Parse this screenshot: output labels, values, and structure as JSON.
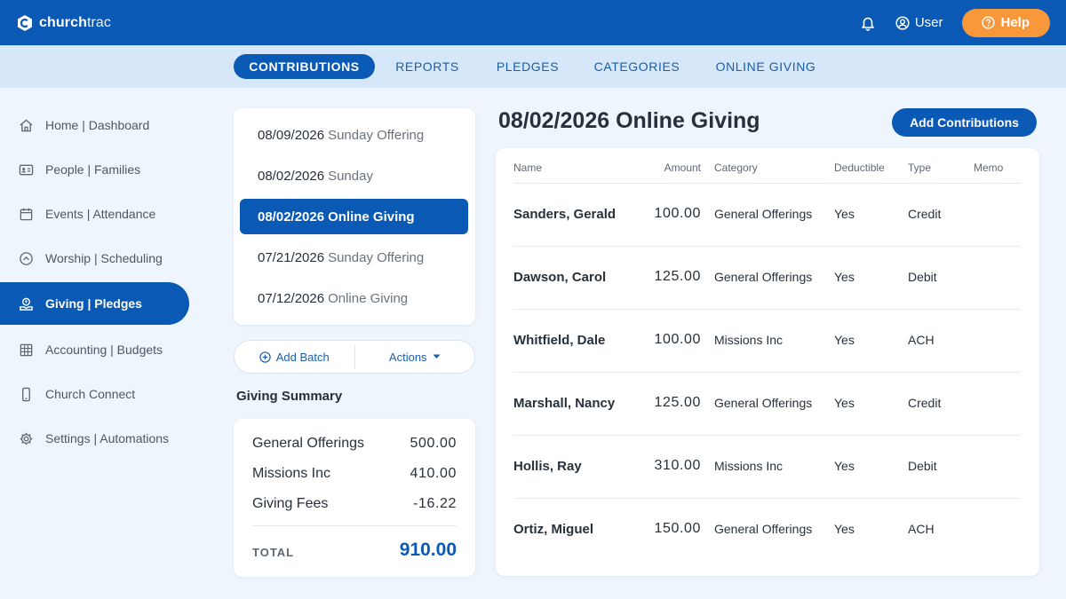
{
  "app": {
    "brand_bold": "church",
    "brand_light": "trac"
  },
  "header": {
    "user_label": "User",
    "help_label": "Help"
  },
  "tabs": [
    {
      "label": "CONTRIBUTIONS",
      "active": true
    },
    {
      "label": "REPORTS",
      "active": false
    },
    {
      "label": "PLEDGES",
      "active": false
    },
    {
      "label": "CATEGORIES",
      "active": false
    },
    {
      "label": "ONLINE GIVING",
      "active": false
    }
  ],
  "sidebar": {
    "items": [
      {
        "label": "Home | Dashboard",
        "icon": "home-icon"
      },
      {
        "label": "People | Families",
        "icon": "id-card-icon"
      },
      {
        "label": "Events | Attendance",
        "icon": "calendar-icon"
      },
      {
        "label": "Worship | Scheduling",
        "icon": "chevron-circle-icon"
      },
      {
        "label": "Giving | Pledges",
        "icon": "giving-hand-icon",
        "active": true
      },
      {
        "label": "Accounting | Budgets",
        "icon": "grid-icon"
      },
      {
        "label": "Church Connect",
        "icon": "phone-icon"
      },
      {
        "label": "Settings | Automations",
        "icon": "gear-icon"
      }
    ]
  },
  "batches": [
    {
      "date": "08/09/2026",
      "name": "Sunday Offering"
    },
    {
      "date": "08/02/2026",
      "name": "Sunday"
    },
    {
      "date": "08/02/2026",
      "name": "Online Giving",
      "active": true
    },
    {
      "date": "07/21/2026",
      "name": "Sunday Offering"
    },
    {
      "date": "07/12/2026",
      "name": "Online Giving"
    }
  ],
  "batch_actions": {
    "add_label": "Add Batch",
    "actions_label": "Actions"
  },
  "summary": {
    "title": "Giving Summary",
    "rows": [
      {
        "label": "General Offerings",
        "value": "500.00"
      },
      {
        "label": "Missions Inc",
        "value": "410.00"
      },
      {
        "label": "Giving Fees",
        "value": "-16.22"
      }
    ],
    "total_label": "TOTAL",
    "total_value": "910.00"
  },
  "main": {
    "title": "08/02/2026 Online Giving",
    "add_button": "Add Contributions",
    "columns": {
      "name": "Name",
      "amount": "Amount",
      "category": "Category",
      "deductible": "Deductible",
      "type": "Type",
      "memo": "Memo"
    },
    "rows": [
      {
        "name": "Sanders, Gerald",
        "amount": "100.00",
        "category": "General Offerings",
        "deductible": "Yes",
        "type": "Credit",
        "memo": ""
      },
      {
        "name": "Dawson, Carol",
        "amount": "125.00",
        "category": "General Offerings",
        "deductible": "Yes",
        "type": "Debit",
        "memo": ""
      },
      {
        "name": "Whitfield, Dale",
        "amount": "100.00",
        "category": "Missions Inc",
        "deductible": "Yes",
        "type": "ACH",
        "memo": ""
      },
      {
        "name": "Marshall, Nancy",
        "amount": "125.00",
        "category": "General Offerings",
        "deductible": "Yes",
        "type": "Credit",
        "memo": ""
      },
      {
        "name": "Hollis, Ray",
        "amount": "310.00",
        "category": "Missions Inc",
        "deductible": "Yes",
        "type": "Debit",
        "memo": ""
      },
      {
        "name": "Ortiz, Miguel",
        "amount": "150.00",
        "category": "General Offerings",
        "deductible": "Yes",
        "type": "ACH",
        "memo": ""
      }
    ]
  },
  "colors": {
    "primary": "#0a5ab5",
    "accent": "#f9983a",
    "subnav": "#d5e7f8",
    "background": "#eef5fc"
  }
}
